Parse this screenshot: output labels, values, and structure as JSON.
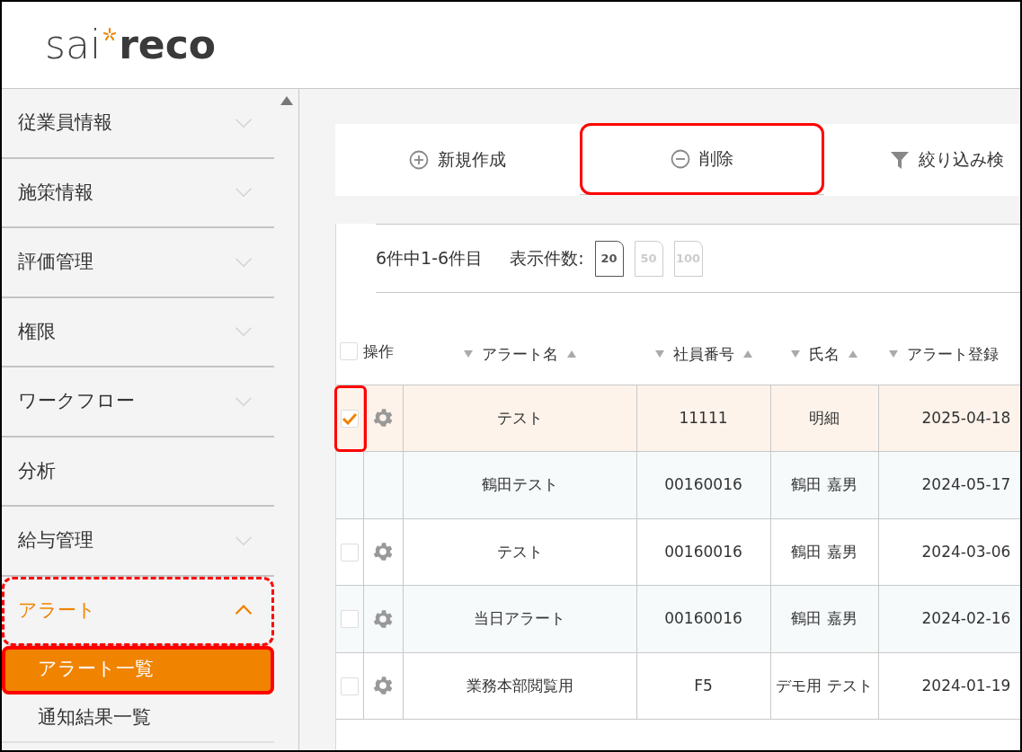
{
  "logo": {
    "light": "sai",
    "bold": "reco"
  },
  "sidebar": {
    "items": [
      {
        "label": "従業員情報",
        "kind": "group",
        "expanded": false,
        "highlighted": false
      },
      {
        "label": "施策情報",
        "kind": "group",
        "expanded": false,
        "highlighted": false
      },
      {
        "label": "評価管理",
        "kind": "group",
        "expanded": false,
        "highlighted": false
      },
      {
        "label": "権限",
        "kind": "group",
        "expanded": false,
        "highlighted": false
      },
      {
        "label": "ワークフロー",
        "kind": "group",
        "expanded": false,
        "highlighted": false
      },
      {
        "label": "分析",
        "kind": "link",
        "expanded": false,
        "highlighted": false
      },
      {
        "label": "給与管理",
        "kind": "group",
        "expanded": false,
        "highlighted": false
      },
      {
        "label": "アラート",
        "kind": "group",
        "expanded": true,
        "highlighted": true,
        "children": [
          {
            "label": "アラート一覧",
            "selected": true,
            "highlighted": true
          },
          {
            "label": "通知結果一覧",
            "selected": false,
            "highlighted": false
          }
        ]
      }
    ]
  },
  "toolbar": [
    {
      "label": "新規作成",
      "kind": "add",
      "highlighted": false
    },
    {
      "label": "削除",
      "kind": "remove",
      "highlighted": true
    },
    {
      "label": "絞り込み検",
      "kind": "filter",
      "highlighted": false
    }
  ],
  "summary": "6件中1-6件目",
  "page_size_label": "表示件数:",
  "page_sizes": [
    {
      "label": "20",
      "selected": true
    },
    {
      "label": "50",
      "selected": false
    },
    {
      "label": "100",
      "selected": false
    }
  ],
  "table": {
    "select_all_checked": false,
    "operation_label": "操作",
    "columns": [
      "アラート名",
      "社員番号",
      "氏名",
      "アラート登録"
    ],
    "rows": [
      {
        "kind": "editable",
        "checked": true,
        "highlighted": true,
        "cells": [
          "テスト",
          "11111",
          "明細",
          "2025-04-18"
        ]
      },
      {
        "kind": "readonly",
        "checked": false,
        "highlighted": false,
        "cells": [
          "鶴田テスト",
          "00160016",
          "鶴田 嘉男",
          "2024-05-17"
        ]
      },
      {
        "kind": "editable",
        "checked": false,
        "highlighted": false,
        "cells": [
          "テスト",
          "00160016",
          "鶴田 嘉男",
          "2024-03-06"
        ]
      },
      {
        "kind": "editable",
        "checked": false,
        "highlighted": false,
        "cells": [
          "当日アラート",
          "00160016",
          "鶴田 嘉男",
          "2024-02-16"
        ]
      },
      {
        "kind": "editable",
        "checked": false,
        "highlighted": false,
        "cells": [
          "業務本部閲覧用",
          "F5",
          "デモ用 テスト",
          "2024-01-19"
        ]
      }
    ]
  }
}
